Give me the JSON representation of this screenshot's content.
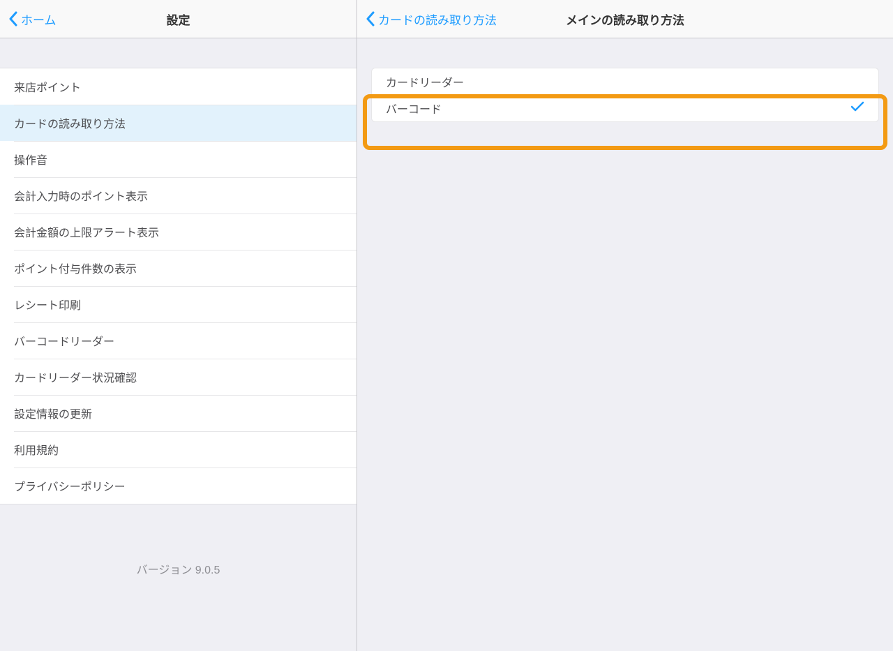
{
  "left": {
    "back_label": "ホーム",
    "title": "設定",
    "menu": [
      "来店ポイント",
      "カードの読み取り方法",
      "操作音",
      "会計入力時のポイント表示",
      "会計金額の上限アラート表示",
      "ポイント付与件数の表示",
      "レシート印刷",
      "バーコードリーダー",
      "カードリーダー状況確認",
      "設定情報の更新",
      "利用規約",
      "プライバシーポリシー"
    ],
    "selected_index": 1,
    "version_label": "バージョン 9.0.5"
  },
  "right": {
    "back_label": "カードの読み取り方法",
    "title": "メインの読み取り方法",
    "options": [
      "カードリーダー",
      "バーコード"
    ],
    "selected_option_index": 1,
    "highlight_option_index": 1
  }
}
